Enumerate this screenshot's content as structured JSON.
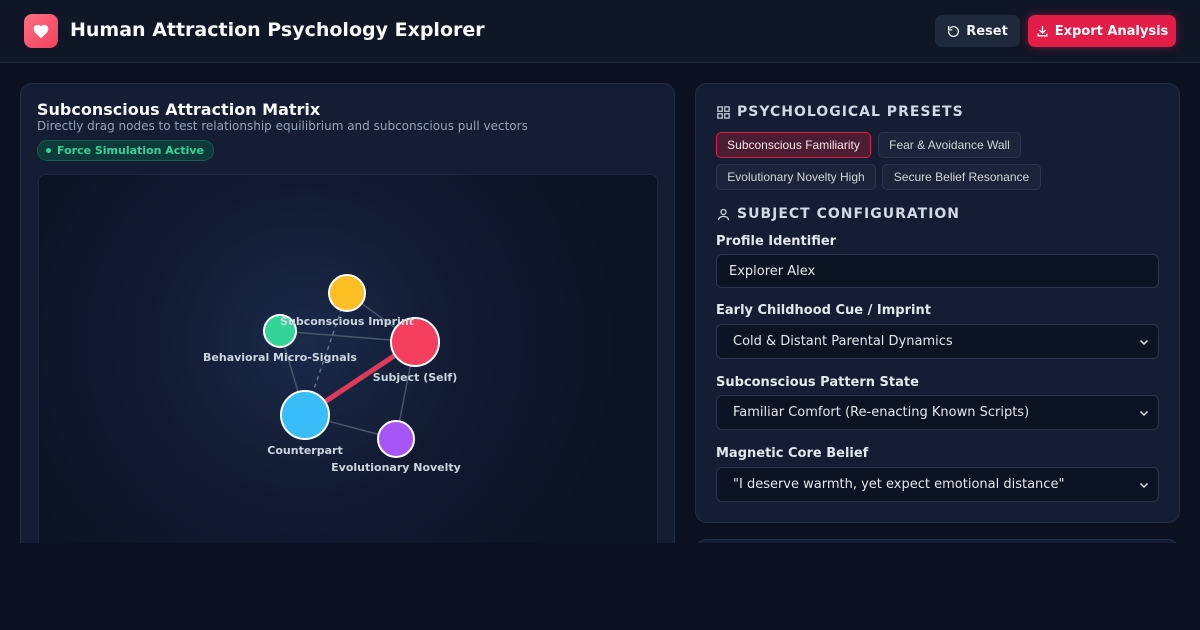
{
  "header": {
    "title": "Human Attraction Psychology Explorer",
    "reset_label": "Reset",
    "export_label": "Export Analysis",
    "logo_icon": "heart-icon"
  },
  "matrix": {
    "title": "Subconscious Attraction Matrix",
    "subtitle": "Directly drag nodes to test relationship equilibrium and subconscious pull vectors",
    "badge": "Force Simulation Active",
    "nodes": [
      {
        "label": "Subconscious Imprint",
        "color": "#fbbf24"
      },
      {
        "label": "Behavioral Micro-Signals",
        "color": "#34d399"
      },
      {
        "label": "Subject (Self)",
        "color": "#f43f5e"
      },
      {
        "label": "Counterpart",
        "color": "#38bdf8"
      },
      {
        "label": "Evolutionary Novelty",
        "color": "#a855f7"
      }
    ]
  },
  "presets": {
    "title": "PSYCHOLOGICAL PRESETS",
    "items": [
      "Subconscious Familiarity",
      "Fear & Avoidance Wall",
      "Evolutionary Novelty High",
      "Secure Belief Resonance"
    ],
    "active": "Subconscious Familiarity"
  },
  "config": {
    "title": "SUBJECT CONFIGURATION",
    "profile_label": "Profile Identifier",
    "profile_value": "Explorer Alex",
    "imprint_label": "Early Childhood Cue / Imprint",
    "imprint_value": "Cold & Distant Parental Dynamics",
    "pattern_label": "Subconscious Pattern State",
    "pattern_value": "Familiar Comfort (Re-enacting Known Scripts)",
    "belief_label": "Magnetic Core Belief",
    "belief_value": "\"I deserve warmth, yet expect emotional distance\""
  },
  "colors": {
    "accent": "#e11d48",
    "success": "#34d399",
    "background": "#0b1120"
  }
}
